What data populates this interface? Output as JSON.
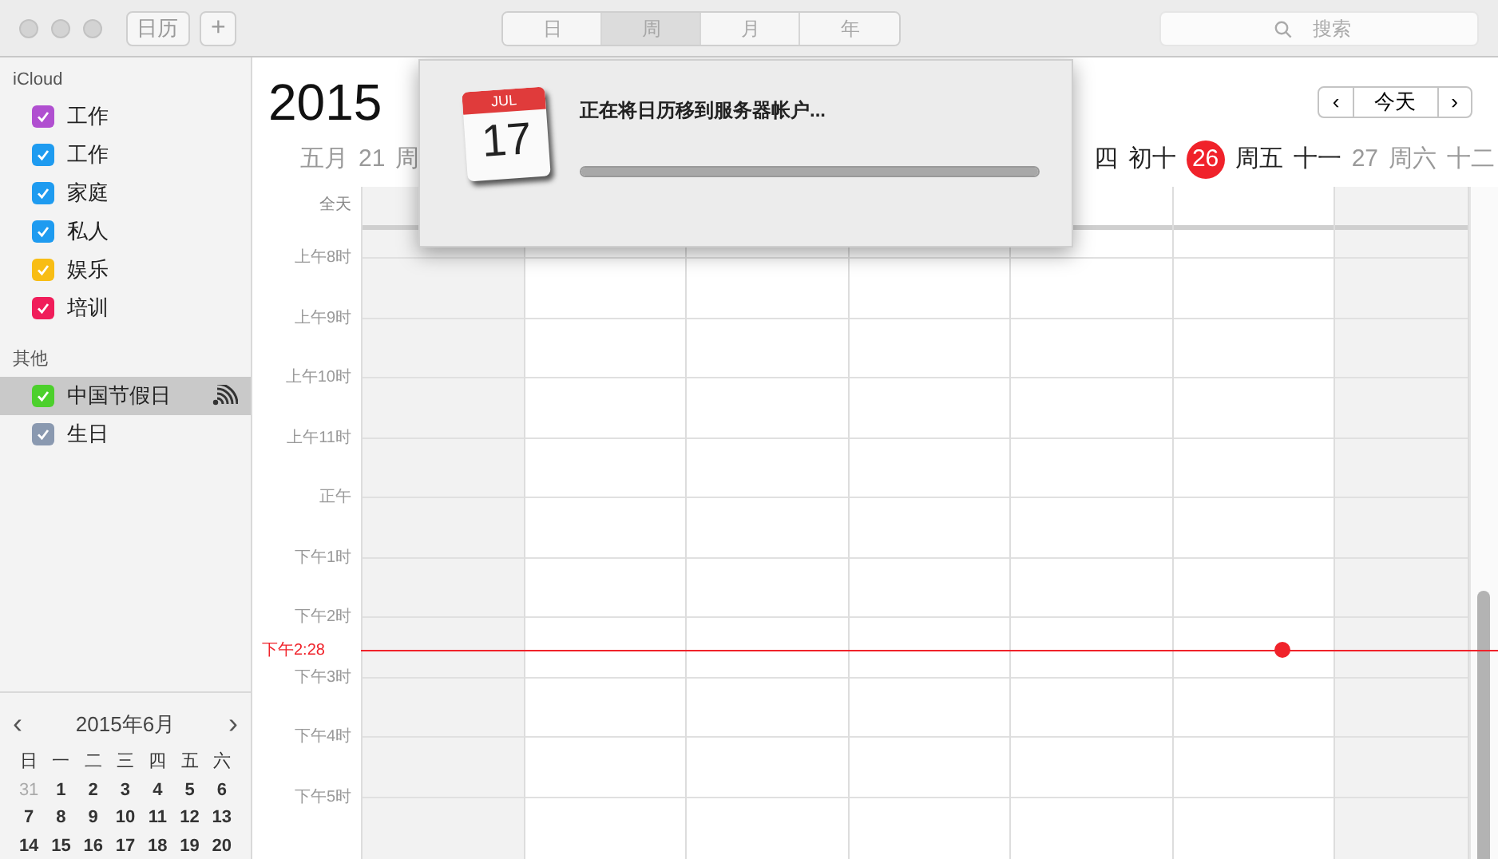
{
  "toolbar": {
    "calendars_button": "日历",
    "add_button": "+",
    "views": [
      {
        "label": "日",
        "selected": false
      },
      {
        "label": "周",
        "selected": true
      },
      {
        "label": "月",
        "selected": false
      },
      {
        "label": "年",
        "selected": false
      }
    ],
    "search": {
      "placeholder": "搜索"
    }
  },
  "sidebar": {
    "groups": [
      {
        "title": "iCloud",
        "items": [
          {
            "label": "工作",
            "checked": true,
            "color": "#b04fd0",
            "selected": false,
            "subscribed": false
          },
          {
            "label": "工作",
            "checked": true,
            "color": "#1e9bf0",
            "selected": false,
            "subscribed": false
          },
          {
            "label": "家庭",
            "checked": true,
            "color": "#1e9bf0",
            "selected": false,
            "subscribed": false
          },
          {
            "label": "私人",
            "checked": true,
            "color": "#1e9bf0",
            "selected": false,
            "subscribed": false
          },
          {
            "label": "娱乐",
            "checked": true,
            "color": "#f8bd14",
            "selected": false,
            "subscribed": false
          },
          {
            "label": "培训",
            "checked": true,
            "color": "#f01d5a",
            "selected": false,
            "subscribed": false
          }
        ]
      },
      {
        "title": "其他",
        "items": [
          {
            "label": "中国节假日",
            "checked": true,
            "color": "#4cd02c",
            "selected": true,
            "subscribed": true
          },
          {
            "label": "生日",
            "checked": true,
            "color": "#8a99b0",
            "selected": false,
            "subscribed": false
          }
        ]
      }
    ],
    "mini_calendar": {
      "prev": "‹",
      "title": "2015年6月",
      "next": "›",
      "weekdays": [
        "日",
        "一",
        "二",
        "三",
        "四",
        "五",
        "六"
      ],
      "days": [
        {
          "text": "31",
          "other_month": true
        },
        {
          "text": "1",
          "other_month": false
        },
        {
          "text": "2",
          "other_month": false
        },
        {
          "text": "3",
          "other_month": false
        },
        {
          "text": "4",
          "other_month": false
        },
        {
          "text": "5",
          "other_month": false
        },
        {
          "text": "6",
          "other_month": false
        },
        {
          "text": "7",
          "other_month": false
        },
        {
          "text": "8",
          "other_month": false
        },
        {
          "text": "9",
          "other_month": false
        },
        {
          "text": "10",
          "other_month": false
        },
        {
          "text": "11",
          "other_month": false
        },
        {
          "text": "12",
          "other_month": false
        },
        {
          "text": "13",
          "other_month": false
        },
        {
          "text": "14",
          "other_month": false
        },
        {
          "text": "15",
          "other_month": false
        },
        {
          "text": "16",
          "other_month": false
        },
        {
          "text": "17",
          "other_month": false
        },
        {
          "text": "18",
          "other_month": false
        },
        {
          "text": "19",
          "other_month": false
        },
        {
          "text": "20",
          "other_month": false
        }
      ]
    }
  },
  "week": {
    "title": "2015",
    "prev": "‹",
    "today_button": "今天",
    "next": "›",
    "header_left": [
      {
        "text": "五月",
        "muted": true,
        "today": false
      },
      {
        "text": "21",
        "muted": true,
        "today": false
      },
      {
        "text": "周",
        "muted": true,
        "today": false
      }
    ],
    "header_right": [
      {
        "text": "四",
        "muted": false,
        "today": false
      },
      {
        "text": "初十",
        "muted": false,
        "today": false
      },
      {
        "text": "26",
        "muted": false,
        "today": true
      },
      {
        "text": "周五",
        "muted": false,
        "today": false
      },
      {
        "text": "十一",
        "muted": false,
        "today": false
      },
      {
        "text": "27",
        "muted": true,
        "today": false
      },
      {
        "text": "周六",
        "muted": true,
        "today": false
      },
      {
        "text": "十二",
        "muted": true,
        "today": false
      }
    ],
    "all_day_label": "全天",
    "hours": [
      "上午8时",
      "上午9时",
      "上午10时",
      "上午11时",
      "正午",
      "下午1时",
      "下午2时",
      "下午3时",
      "下午4时",
      "下午5时"
    ],
    "columns": [
      {
        "weekend": true,
        "today": false
      },
      {
        "weekend": false,
        "today": false
      },
      {
        "weekend": false,
        "today": false
      },
      {
        "weekend": false,
        "today": false
      },
      {
        "weekend": false,
        "today": false
      },
      {
        "weekend": false,
        "today": true
      },
      {
        "weekend": true,
        "today": false
      }
    ],
    "now_label": "下午2:28"
  },
  "dialog": {
    "icon_month": "JUL",
    "icon_day": "17",
    "message": "正在将日历移到服务器帐户...",
    "progress": {
      "level": 1
    }
  }
}
